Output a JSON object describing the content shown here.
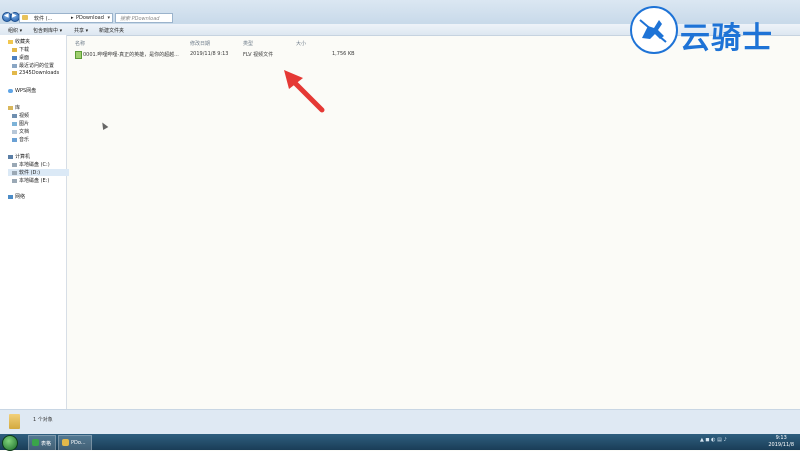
{
  "window": {
    "address": [
      "软件 (...",
      "PDownload"
    ],
    "search_placeholder": "搜索 PDownload"
  },
  "toolbar": [
    "组织 ▾",
    "包含到库中 ▾",
    "共享 ▾",
    "新建文件夹"
  ],
  "nav": {
    "favorites": [
      "收藏夹",
      "下载",
      "桌面",
      "最近访问的位置",
      "2345Downloads"
    ],
    "wps": "WPS网盘",
    "libraries": [
      "库",
      "视频",
      "图片",
      "文档",
      "音乐"
    ],
    "computer": [
      "计算机",
      "本地磁盘 (C:)",
      "软件 (D:)",
      "本地磁盘 (E:)"
    ],
    "network": "网络"
  },
  "columns": [
    "名称",
    "修改日期",
    "类型",
    "大小"
  ],
  "file": {
    "name": "0001.哔哩哔哩-真正的英雄，是你的超越...",
    "date": "2019/11/8 9:13",
    "type": "FLV 视频文件",
    "size": "1,756 KB"
  },
  "status": {
    "count": "1 个对象"
  },
  "taskbar": {
    "items": [
      {
        "label": "表格"
      },
      {
        "label": "PDo..."
      }
    ],
    "time": "9:13",
    "date": "2019/11/8"
  },
  "watermark": {
    "text": "云骑士"
  },
  "colors": {
    "accent": "#1e73d6",
    "arrow": "#e53935"
  }
}
